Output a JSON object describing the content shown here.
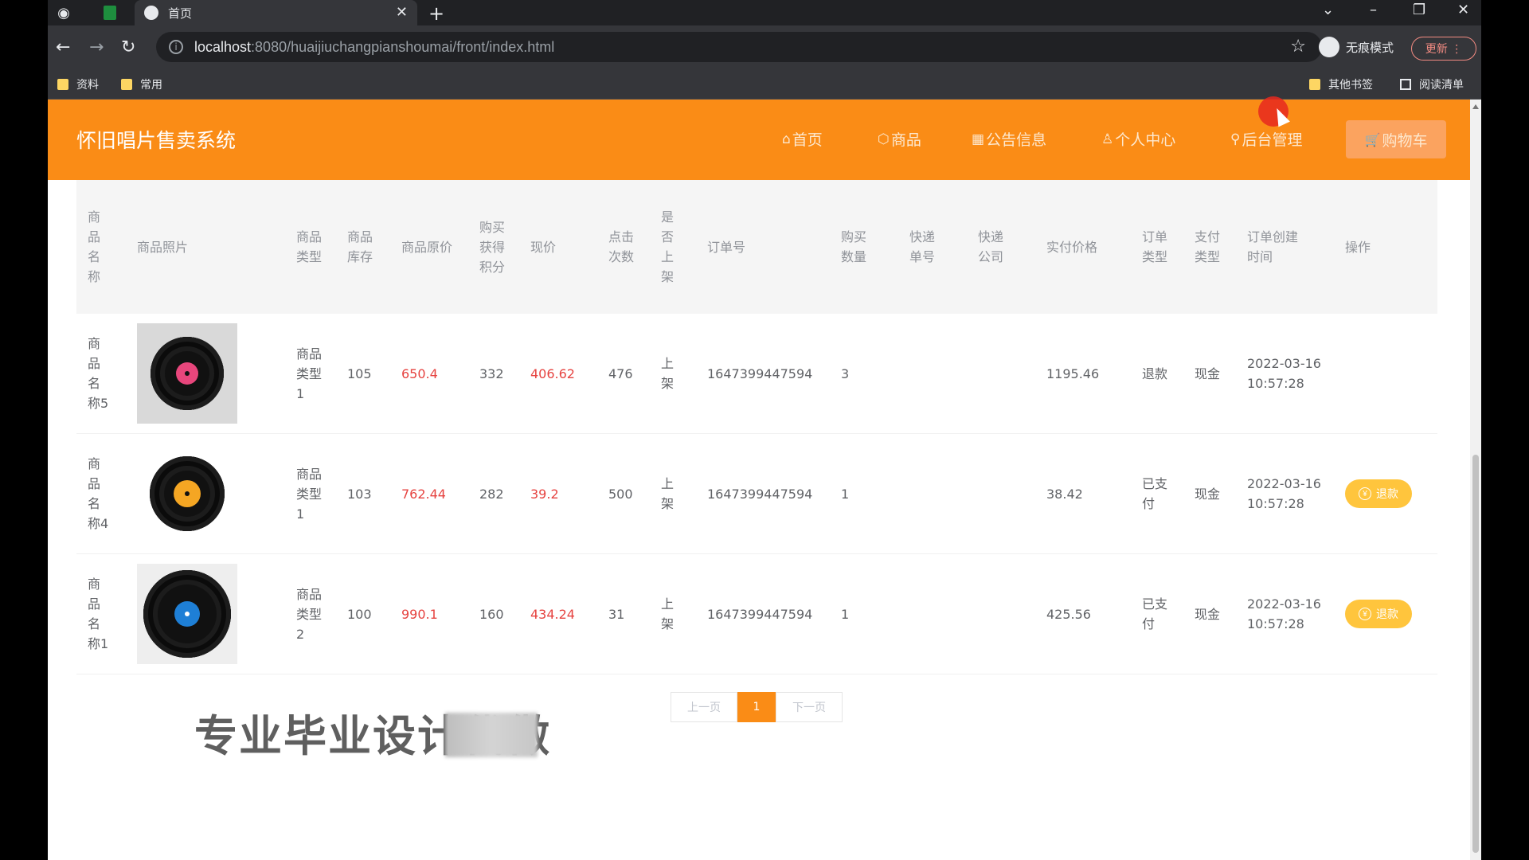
{
  "browser": {
    "tab_title": "首页",
    "new_tab": "+",
    "url_host": "localhost",
    "url_rest": ":8080/huaijiuchangpianshoumai/front/index.html",
    "incognito_label": "无痕模式",
    "update_label": "更新 ⋮",
    "bookmarks": [
      {
        "label": "资料"
      },
      {
        "label": "常用"
      },
      {
        "label": "其他书签"
      },
      {
        "label": "阅读清单"
      }
    ]
  },
  "site": {
    "title": "怀旧唱片售卖系统",
    "nav": [
      {
        "icon": "home-icon",
        "glyph": "⌂",
        "label": "首页"
      },
      {
        "icon": "goods-icon",
        "glyph": "⬡",
        "label": "商品"
      },
      {
        "icon": "grid-icon",
        "glyph": "▦",
        "label": "公告信息"
      },
      {
        "icon": "user-icon",
        "glyph": "♙",
        "label": "个人中心"
      },
      {
        "icon": "link-icon",
        "glyph": "⚲",
        "label": "后台管理"
      }
    ],
    "cart": {
      "glyph": "🛒",
      "label": "购物车"
    },
    "accent": "#fa8c16"
  },
  "table": {
    "headers": [
      "商品名称",
      "商品照片",
      "商品类型",
      "商品库存",
      "商品原价",
      "购买获得积分",
      "现价",
      "点击次数",
      "是否上架",
      "订单号",
      "购买数量",
      "快递单号",
      "快递公司",
      "实付价格",
      "订单类型",
      "支付类型",
      "订单创建时间",
      "操作"
    ],
    "rows": [
      {
        "name": "商品名称5",
        "type": "商品类型1",
        "stock": "105",
        "orig_price": "650.4",
        "points": "332",
        "price": "406.62",
        "clicks": "476",
        "on_shelf": "上架",
        "order_no": "1647399447594",
        "qty": "3",
        "express_no": "",
        "express_co": "",
        "paid": "1195.46",
        "order_type": "退款",
        "pay_type": "现金",
        "created": "2022-03-16 10:57:28",
        "action": "",
        "disc": {
          "outer": "#1a1a1a",
          "label": "#e8467c",
          "bg": "#d9d9d9"
        }
      },
      {
        "name": "商品名称4",
        "type": "商品类型1",
        "stock": "103",
        "orig_price": "762.44",
        "points": "282",
        "price": "39.2",
        "clicks": "500",
        "on_shelf": "上架",
        "order_no": "1647399447594",
        "qty": "1",
        "express_no": "",
        "express_co": "",
        "paid": "38.42",
        "order_type": "已支付",
        "pay_type": "现金",
        "created": "2022-03-16 10:57:28",
        "action": "退款",
        "disc": {
          "outer": "#111111",
          "label": "#f5a623",
          "bg": "#ffffff"
        }
      },
      {
        "name": "商品名称1",
        "type": "商品类型2",
        "stock": "100",
        "orig_price": "990.1",
        "points": "160",
        "price": "434.24",
        "clicks": "31",
        "on_shelf": "上架",
        "order_no": "1647399447594",
        "qty": "1",
        "express_no": "",
        "express_co": "",
        "paid": "425.56",
        "order_type": "已支付",
        "pay_type": "现金",
        "created": "2022-03-16 10:57:28",
        "action": "退款",
        "disc": {
          "outer": "#111111",
          "label": "#1e7fd6",
          "bg": "#eeeeee"
        }
      }
    ]
  },
  "pagination": {
    "prev": "上一页",
    "current": "1",
    "next": "下一页"
  },
  "watermark": "专业毕业设计代做"
}
